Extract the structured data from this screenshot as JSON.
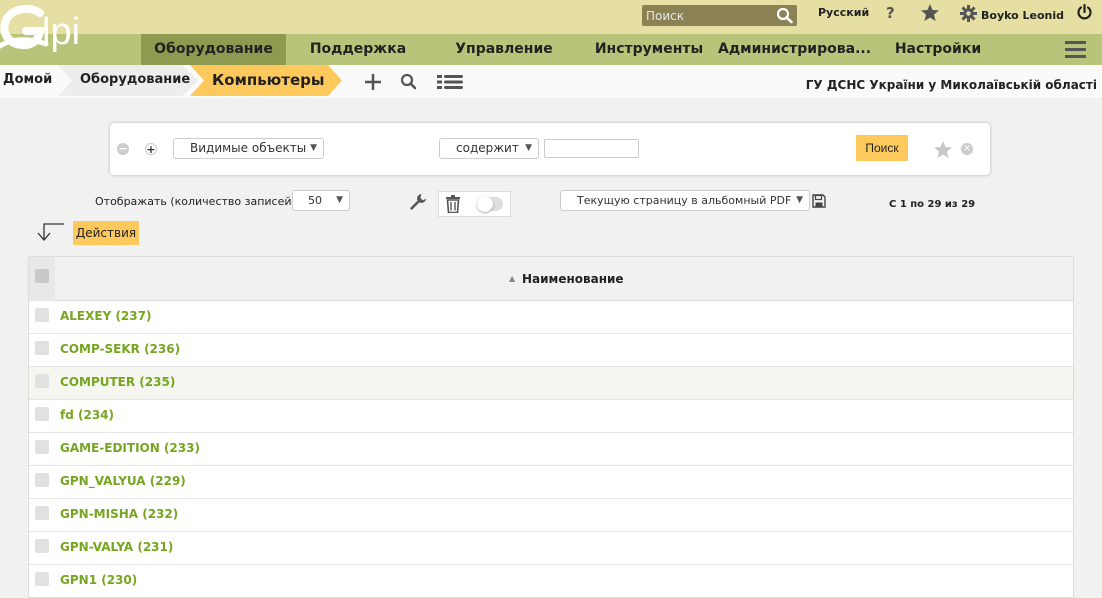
{
  "header": {
    "search_placeholder": "Поиск",
    "language": "Русский",
    "help": "?",
    "user_name": "Boyko Leonid"
  },
  "nav": {
    "items": [
      {
        "label": "Оборудование",
        "active": true
      },
      {
        "label": "Поддержка"
      },
      {
        "label": "Управление"
      },
      {
        "label": "Инструменты"
      },
      {
        "label": "Администрирова..."
      },
      {
        "label": "Настройки"
      }
    ]
  },
  "breadcrumb": {
    "home": "Домой",
    "section": "Оборудование",
    "current": "Компьютеры"
  },
  "entity": "ГУ ДСНС України у Миколаївській області",
  "criteria": {
    "field": "Видимые объекты",
    "condition": "содержит",
    "value": "",
    "search_label": "Поиск"
  },
  "controls": {
    "display_label": "Отображать (количество записей)",
    "display_count": "50",
    "export_option": "Текущую страницу в альбомный PDF",
    "pager": "С 1 по 29 из 29",
    "actions_label": "Действия"
  },
  "table": {
    "column_header": "Наименование",
    "rows": [
      "ALEXEY (237)",
      "COMP-SEKR (236)",
      "COMPUTER (235)",
      "fd (234)",
      "GAME-EDITION (233)",
      "GPN_VALYUA (229)",
      "GPN-MISHA (232)",
      "GPN-VALYA (231)",
      "GPN1 (230)"
    ]
  },
  "colors": {
    "header_bg": "#e6dfa3",
    "nav_bg": "#b8c47a",
    "nav_active": "#8f9a51",
    "accent": "#fec95c",
    "link": "#76a51f"
  }
}
